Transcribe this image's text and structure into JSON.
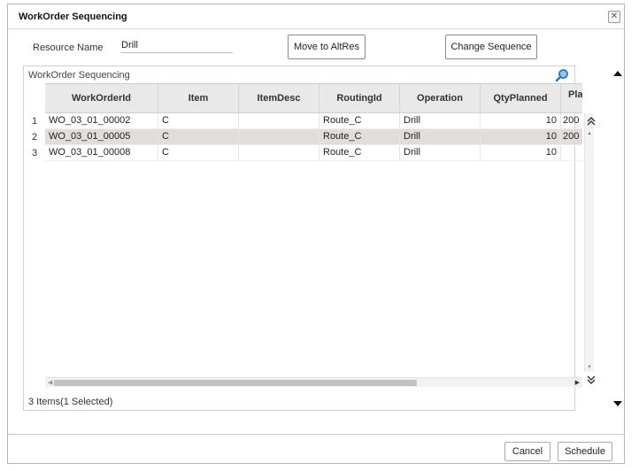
{
  "dialog": {
    "title": "WorkOrder Sequencing",
    "close_icon": "close-icon"
  },
  "resource": {
    "label": "Resource Name",
    "value": "Drill"
  },
  "buttons": {
    "move_to_altres": "Move to AltRes",
    "change_sequence": "Change Sequence",
    "cancel": "Cancel",
    "schedule": "Schedule"
  },
  "grid": {
    "caption": "WorkOrder Sequencing",
    "search_icon": "search-icon",
    "columns": [
      "WorkOrderId",
      "Item",
      "ItemDesc",
      "RoutingId",
      "Operation",
      "QtyPlanned",
      "Pla"
    ],
    "rows": [
      {
        "num": "1",
        "cells": [
          "WO_03_01_00002",
          "C",
          "",
          "Route_C",
          "Drill",
          "10",
          "200"
        ],
        "selected": false
      },
      {
        "num": "2",
        "cells": [
          "WO_03_01_00005",
          "C",
          "",
          "Route_C",
          "Drill",
          "10",
          "200"
        ],
        "selected": true
      },
      {
        "num": "3",
        "cells": [
          "WO_03_01_00008",
          "C",
          "",
          "Route_C",
          "Drill",
          "10",
          ""
        ],
        "selected": false
      }
    ],
    "footer": "3 Items(1 Selected)"
  },
  "colors": {
    "selected_row": "#e2dcdc",
    "header_bg": "#e9e9e9",
    "search_icon": "#2a6fb0"
  }
}
